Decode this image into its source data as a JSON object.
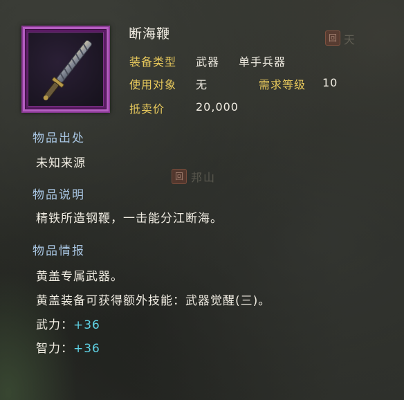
{
  "item": {
    "name": "断海鞭",
    "type_label": "装备类型",
    "type_value": "武器",
    "subtype_value": "单手兵器",
    "target_label": "使用对象",
    "target_value": "无",
    "level_label": "需求等级",
    "level_value": "10",
    "price_label": "抵卖价",
    "price_value": "20,000",
    "frame_color": "#8a3a94"
  },
  "source": {
    "title": "物品出处",
    "text": "未知来源"
  },
  "description": {
    "title": "物品说明",
    "text": "精铁所造钢鞭，一击能分江断海。"
  },
  "info": {
    "title": "物品情报",
    "line1": "黄盖专属武器。",
    "line2": "黄盖装备可获得额外技能：武器觉醒(三)。",
    "stat1_label": "武力：",
    "stat1_value": "+36",
    "stat2_label": "智力：",
    "stat2_value": "+36"
  },
  "background_map": {
    "label1": "天",
    "label2": "邦山",
    "badge1": "回",
    "badge2": "回"
  }
}
